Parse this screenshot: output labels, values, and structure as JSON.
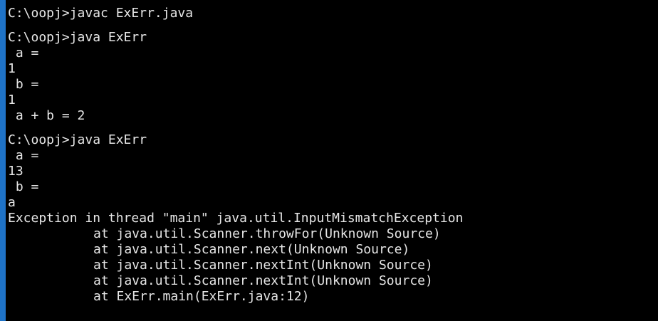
{
  "console": {
    "lines": [
      "C:\\oopj>javac ExErr.java",
      "",
      "C:\\oopj>java ExErr",
      " a =",
      "1",
      " b =",
      "1",
      " a + b = 2",
      "",
      "C:\\oopj>java ExErr",
      " a =",
      "13",
      " b =",
      "a",
      "Exception in thread \"main\" java.util.InputMismatchException",
      "at java.util.Scanner.throwFor(Unknown Source)",
      "at java.util.Scanner.next(Unknown Source)",
      "at java.util.Scanner.nextInt(Unknown Source)",
      "at java.util.Scanner.nextInt(Unknown Source)",
      "at ExErr.main(ExErr.java:12)"
    ]
  },
  "colors": {
    "background": "#000000",
    "text": "#e6e6e6",
    "window_border": "#1f73c7"
  }
}
